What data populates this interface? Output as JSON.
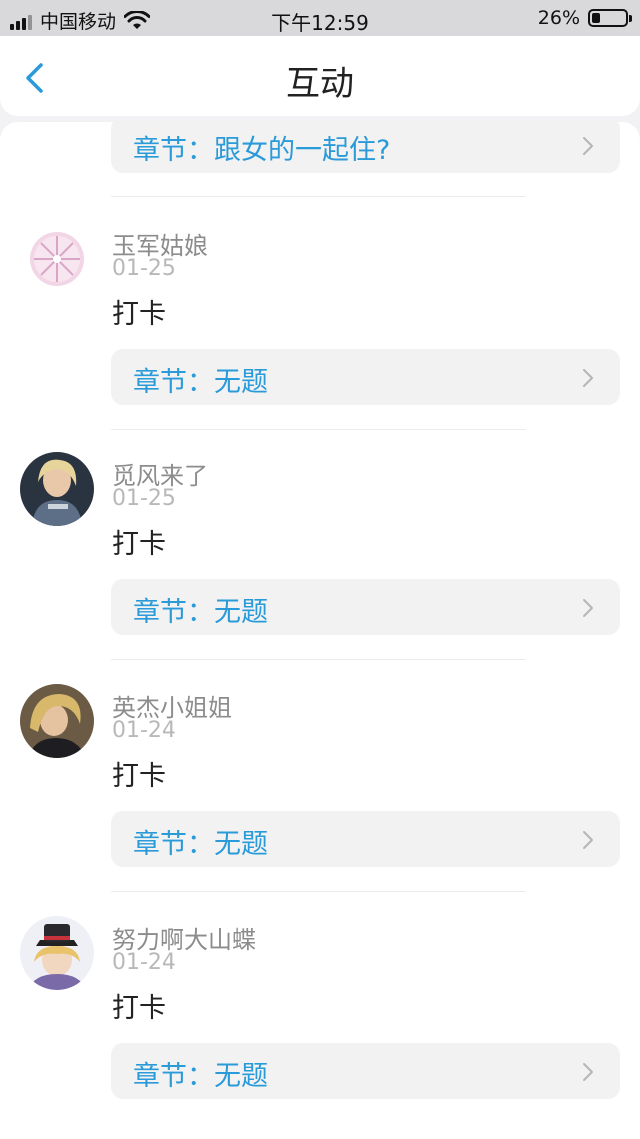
{
  "status_bar": {
    "carrier": "中国移动",
    "time": "下午12:59",
    "battery": "26%",
    "battery_level": 0.26
  },
  "nav": {
    "title": "互动",
    "back_icon": "chevron-left-icon"
  },
  "first_chapter": {
    "label": "章节：跟女的一起住?"
  },
  "comments": [
    {
      "username": "玉军姑娘",
      "date": "01-25",
      "message": "打卡",
      "chapter": "章节：无题"
    },
    {
      "username": "觅风来了",
      "date": "01-25",
      "message": "打卡",
      "chapter": "章节：无题"
    },
    {
      "username": "英杰小姐姐",
      "date": "01-24",
      "message": "打卡",
      "chapter": "章节：无题"
    },
    {
      "username": "努力啊大山蝶",
      "date": "01-24",
      "message": "打卡",
      "chapter": "章节：无题"
    }
  ],
  "colors": {
    "accent": "#2a9ad9",
    "chapter_bg": "#f2f2f3",
    "status_bar_bg": "#d9d9db"
  }
}
